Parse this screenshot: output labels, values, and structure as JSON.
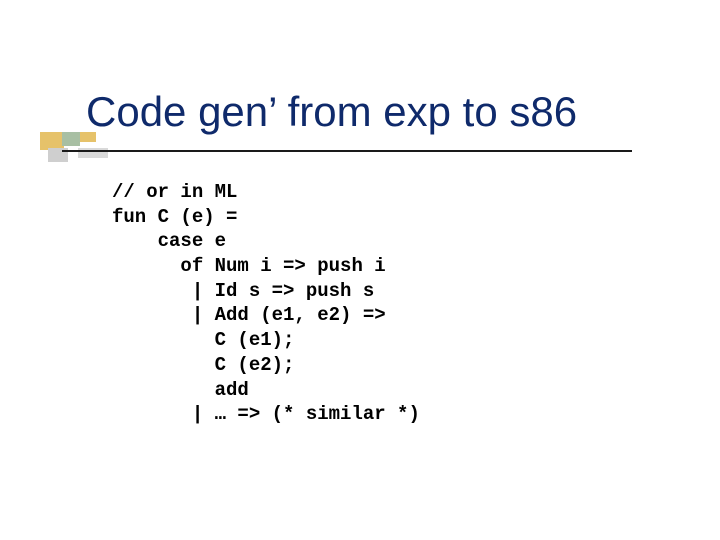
{
  "title": "Code gen’ from exp to s86",
  "code": {
    "l01": "// or in ML",
    "l02": "fun C (e) =",
    "l03": "    case e",
    "l04": "      of Num i => push i",
    "l05": "       | Id s => push s",
    "l06": "       | Add (e1, e2) =>",
    "l07": "         C (e1);",
    "l08": "         C (e2);",
    "l09": "         add",
    "l10": "       | … => (* similar *)"
  }
}
